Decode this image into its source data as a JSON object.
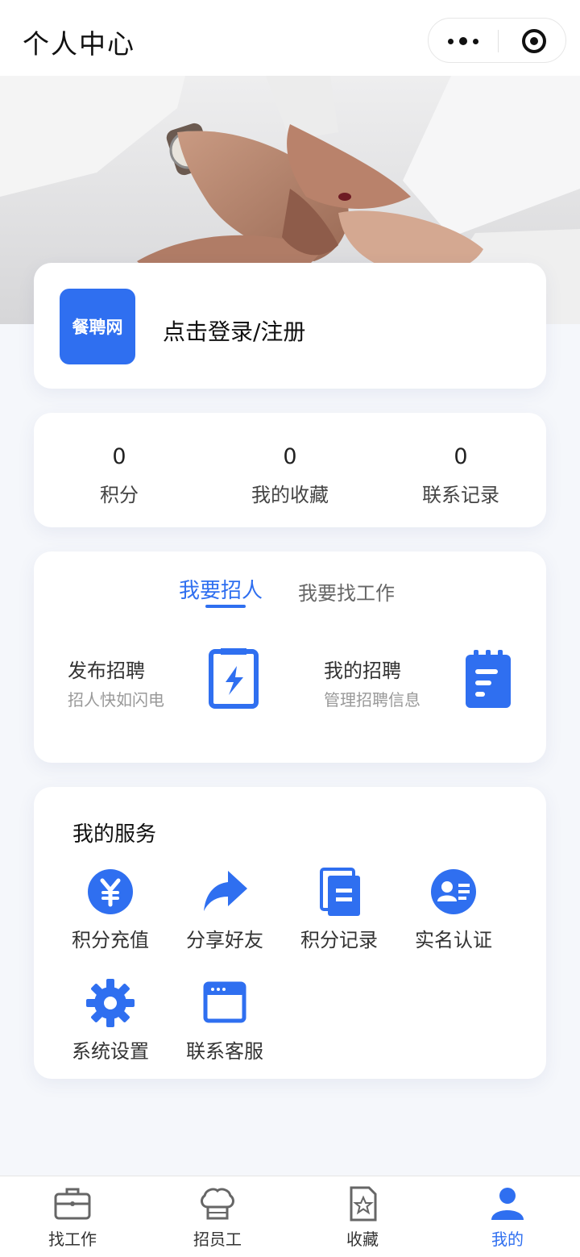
{
  "header": {
    "title": "个人中心"
  },
  "profile": {
    "logo_text": "餐聘网",
    "login_label": "点击登录/注册"
  },
  "stats": [
    {
      "value": "0",
      "label": "积分"
    },
    {
      "value": "0",
      "label": "我的收藏"
    },
    {
      "value": "0",
      "label": "联系记录"
    }
  ],
  "mode_tabs": {
    "active": "我要招人",
    "inactive": "我要找工作"
  },
  "actions": [
    {
      "title": "发布招聘",
      "subtitle": "招人快如闪电",
      "icon": "flash-document-icon"
    },
    {
      "title": "我的招聘",
      "subtitle": "管理招聘信息",
      "icon": "clipboard-icon"
    }
  ],
  "services": {
    "title": "我的服务",
    "items": [
      {
        "label": "积分充值",
        "icon": "yuan-coin-icon"
      },
      {
        "label": "分享好友",
        "icon": "share-arrow-icon"
      },
      {
        "label": "积分记录",
        "icon": "document-stack-icon"
      },
      {
        "label": "实名认证",
        "icon": "id-card-icon"
      },
      {
        "label": "系统设置",
        "icon": "gear-icon"
      },
      {
        "label": "联系客服",
        "icon": "browser-window-icon"
      }
    ]
  },
  "tabbar": [
    {
      "label": "找工作",
      "icon": "briefcase-icon"
    },
    {
      "label": "招员工",
      "icon": "chef-hat-icon"
    },
    {
      "label": "收藏",
      "icon": "star-document-icon"
    },
    {
      "label": "我的",
      "icon": "person-icon",
      "active": true
    }
  ],
  "colors": {
    "accent": "#2f6ff0",
    "background": "#f5f7fb"
  }
}
